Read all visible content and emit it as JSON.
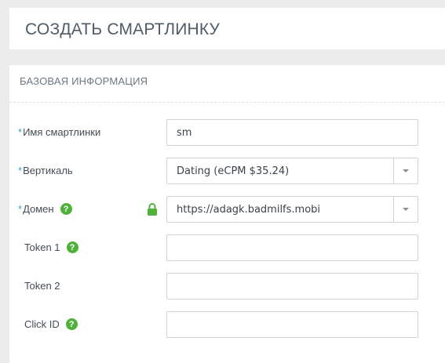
{
  "header": {
    "title": "СОЗДАТЬ СМАРТЛИНКУ"
  },
  "section": {
    "title": "БАЗОВАЯ ИНФОРМАЦИЯ"
  },
  "colors": {
    "required_mark": "#3aa0c9",
    "help_icon": "#4fb13a",
    "lock_icon": "#4fb13a"
  },
  "fields": {
    "name": {
      "required_mark": "*",
      "label": "Имя смартлинки",
      "value": "sm"
    },
    "vertical": {
      "required_mark": "*",
      "label": "Вертикаль",
      "value": "Dating (eCPM $35.24)"
    },
    "domain": {
      "required_mark": "*",
      "label": "Домен",
      "help": "?",
      "value": "https://adagk.badmilfs.mobi"
    },
    "token1": {
      "label": "Token 1",
      "help": "?",
      "value": ""
    },
    "token2": {
      "label": "Token 2",
      "value": ""
    },
    "click_id": {
      "label": "Click ID",
      "help": "?",
      "value": ""
    }
  }
}
